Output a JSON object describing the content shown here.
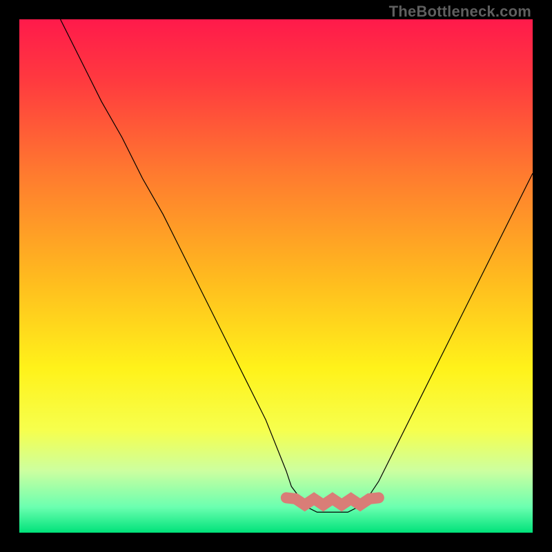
{
  "watermark": "TheBottleneck.com",
  "chart_data": {
    "type": "line",
    "title": "",
    "xlabel": "",
    "ylabel": "",
    "xlim": [
      0,
      100
    ],
    "ylim": [
      0,
      100
    ],
    "background_gradient": {
      "stops": [
        {
          "offset": 0.0,
          "color": "#ff1a4b"
        },
        {
          "offset": 0.12,
          "color": "#ff3a3f"
        },
        {
          "offset": 0.3,
          "color": "#ff7a2f"
        },
        {
          "offset": 0.5,
          "color": "#ffb91f"
        },
        {
          "offset": 0.68,
          "color": "#fff21a"
        },
        {
          "offset": 0.8,
          "color": "#f6ff4d"
        },
        {
          "offset": 0.88,
          "color": "#ccffa0"
        },
        {
          "offset": 0.95,
          "color": "#6bffb0"
        },
        {
          "offset": 1.0,
          "color": "#00e27a"
        }
      ]
    },
    "series": [
      {
        "name": "bottleneck-curve",
        "stroke": "#000000",
        "stroke_width": 1.2,
        "x": [
          8,
          12,
          16,
          20,
          24,
          28,
          32,
          36,
          40,
          44,
          48,
          52,
          53,
          56,
          58,
          60,
          62,
          64,
          66,
          68,
          70,
          74,
          78,
          82,
          86,
          90,
          94,
          98,
          100
        ],
        "y": [
          100,
          92,
          84,
          77,
          69,
          62,
          54,
          46,
          38,
          30,
          22,
          12,
          9,
          5,
          4,
          4,
          4,
          4,
          5,
          7,
          10,
          18,
          26,
          34,
          42,
          50,
          58,
          66,
          70
        ]
      }
    ],
    "marker_band": {
      "name": "optimal-range",
      "color": "#d97d77",
      "x_range": [
        52,
        70
      ],
      "y": 6,
      "thickness": 3.2
    }
  }
}
